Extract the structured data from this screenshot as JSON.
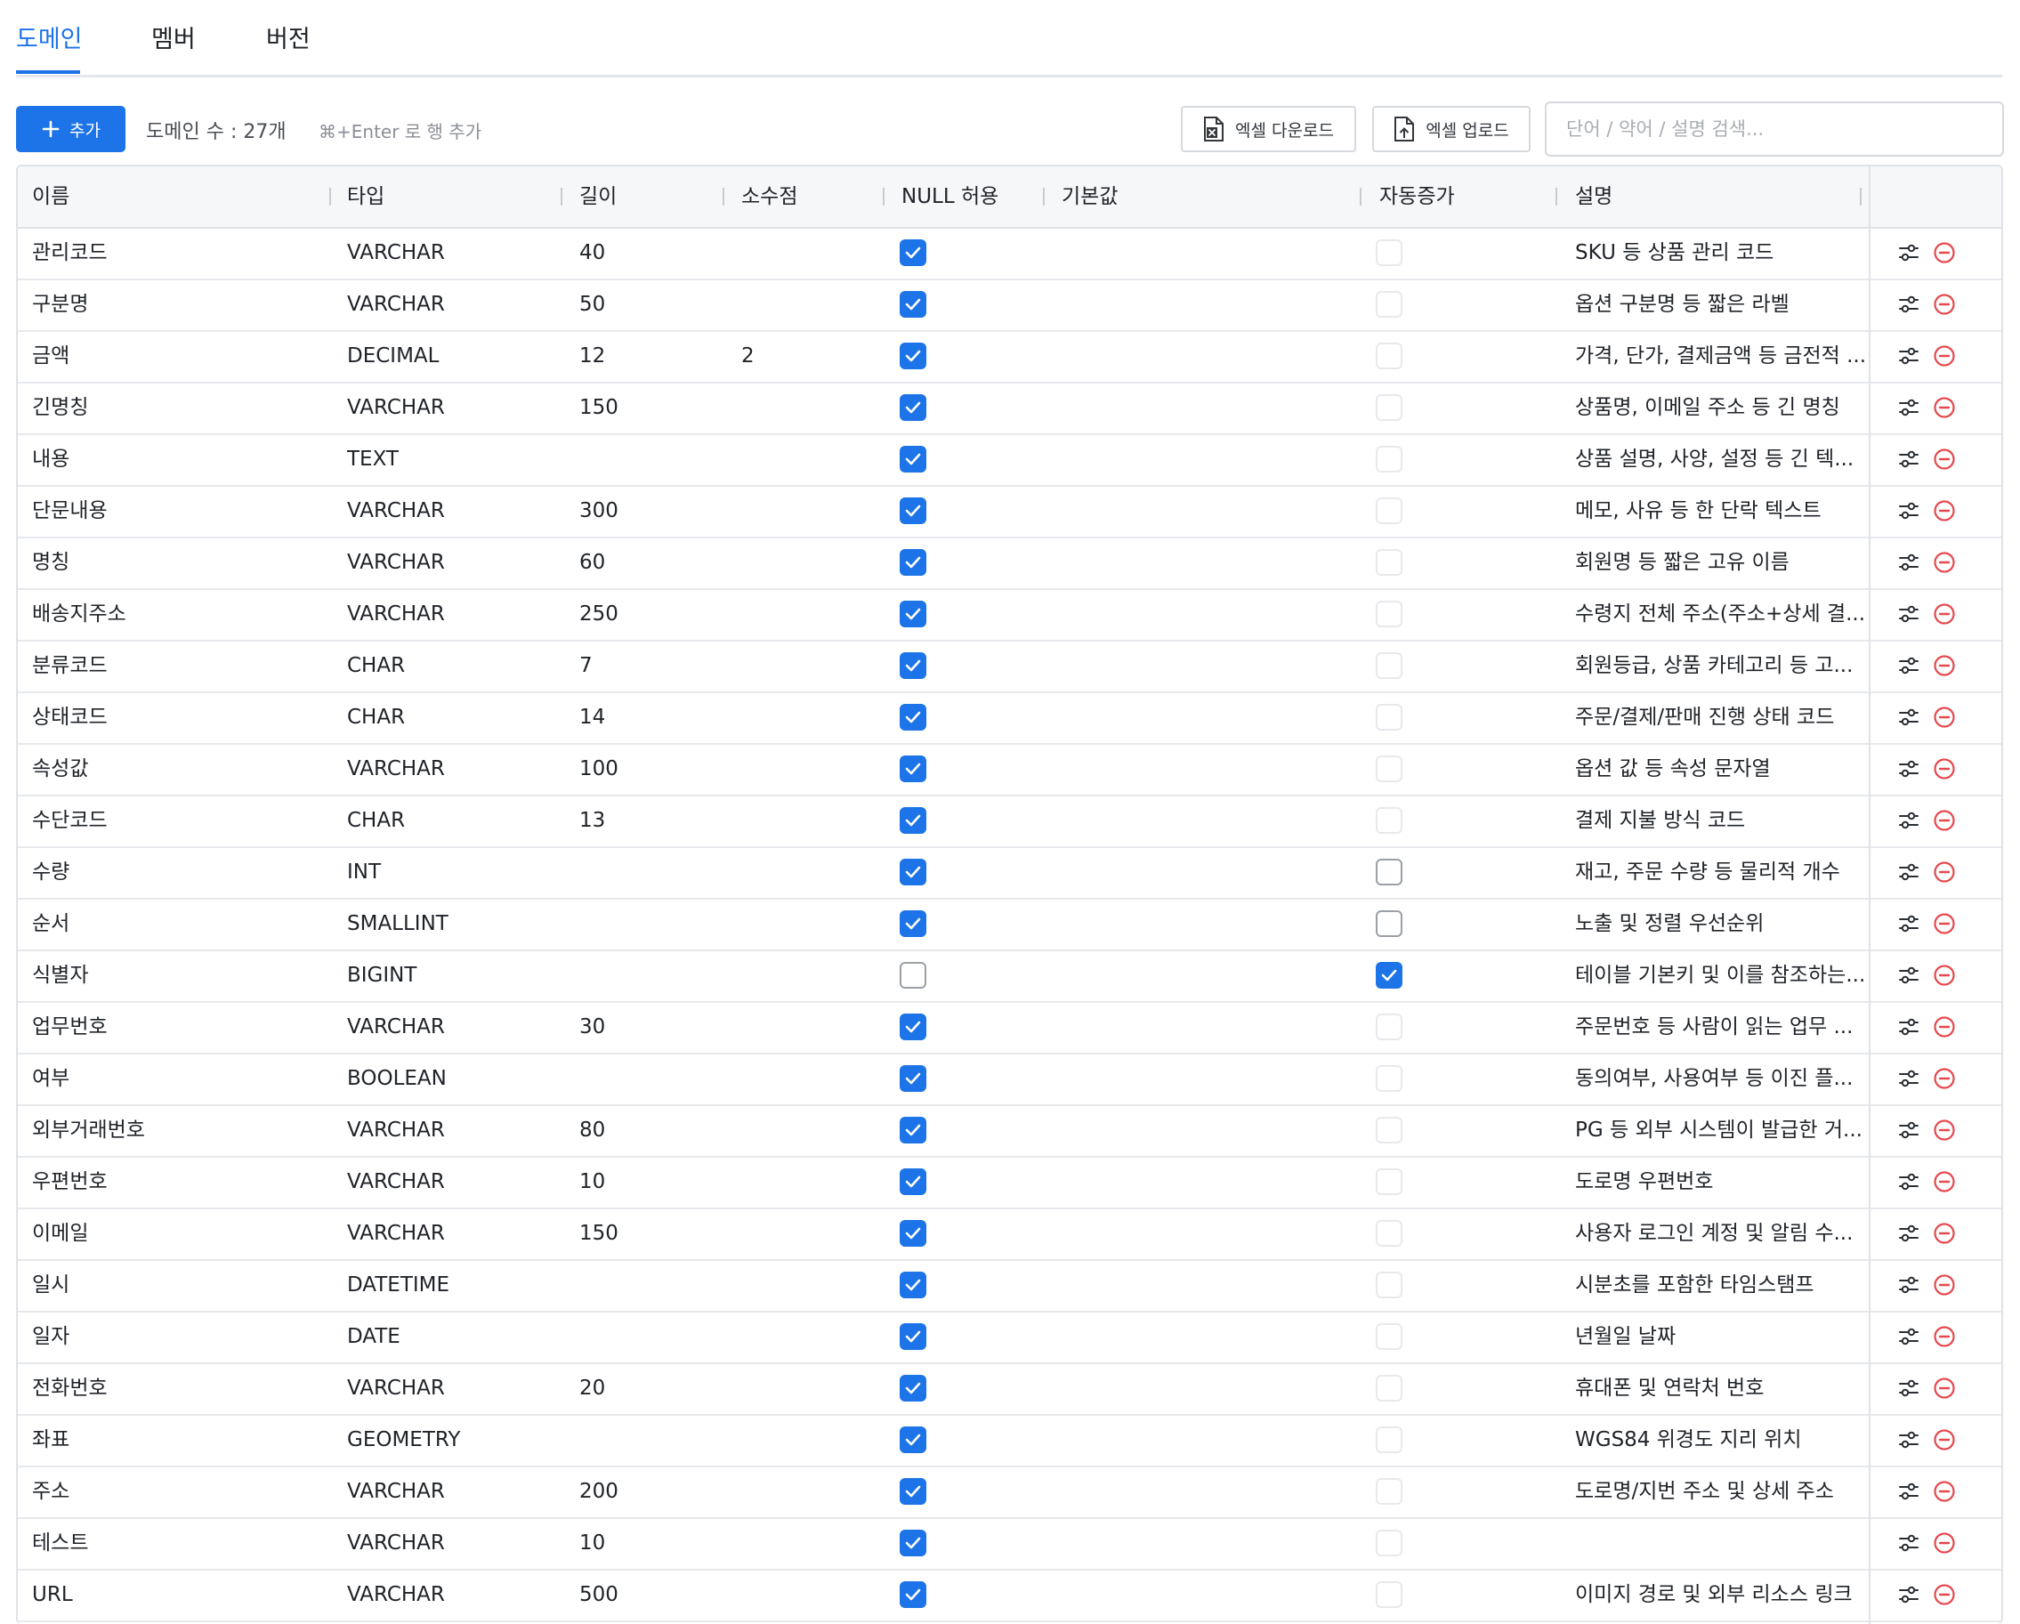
{
  "tabs": [
    {
      "label": "도메인",
      "active": true
    },
    {
      "label": "멤버",
      "active": false
    },
    {
      "label": "버전",
      "active": false
    }
  ],
  "toolbar": {
    "add_label": "추가",
    "count_text": "도메인 수 : 27개",
    "hint_text": "⌘+Enter 로 행 추가",
    "excel_download_label": "엑셀 다운로드",
    "excel_upload_label": "엑셀 업로드",
    "search_placeholder": "단어 / 약어 / 설명 검색..."
  },
  "colors": {
    "accent": "#1d74e8",
    "danger": "#e5484d"
  },
  "table": {
    "headers": [
      "이름",
      "타입",
      "길이",
      "소수점",
      "NULL 허용",
      "기본값",
      "자동증가",
      "설명",
      ""
    ],
    "rows": [
      {
        "name": "관리코드",
        "type": "VARCHAR",
        "length": "40",
        "scale": "",
        "nullable": true,
        "default": "",
        "auto": "disabled",
        "desc": "SKU 등 상품 관리 코드"
      },
      {
        "name": "구분명",
        "type": "VARCHAR",
        "length": "50",
        "scale": "",
        "nullable": true,
        "default": "",
        "auto": "disabled",
        "desc": "옵션 구분명 등 짧은 라벨"
      },
      {
        "name": "금액",
        "type": "DECIMAL",
        "length": "12",
        "scale": "2",
        "nullable": true,
        "default": "",
        "auto": "disabled",
        "desc": "가격, 단가, 결제금액 등 금전적 ..."
      },
      {
        "name": "긴명칭",
        "type": "VARCHAR",
        "length": "150",
        "scale": "",
        "nullable": true,
        "default": "",
        "auto": "disabled",
        "desc": "상품명, 이메일 주소 등 긴 명칭"
      },
      {
        "name": "내용",
        "type": "TEXT",
        "length": "",
        "scale": "",
        "nullable": true,
        "default": "",
        "auto": "disabled",
        "desc": "상품 설명, 사양, 설정 등 긴 텍..."
      },
      {
        "name": "단문내용",
        "type": "VARCHAR",
        "length": "300",
        "scale": "",
        "nullable": true,
        "default": "",
        "auto": "disabled",
        "desc": "메모, 사유 등 한 단락 텍스트"
      },
      {
        "name": "명칭",
        "type": "VARCHAR",
        "length": "60",
        "scale": "",
        "nullable": true,
        "default": "",
        "auto": "disabled",
        "desc": "회원명 등 짧은 고유 이름"
      },
      {
        "name": "배송지주소",
        "type": "VARCHAR",
        "length": "250",
        "scale": "",
        "nullable": true,
        "default": "",
        "auto": "disabled",
        "desc": "수령지 전체 주소(주소+상세 결..."
      },
      {
        "name": "분류코드",
        "type": "CHAR",
        "length": "7",
        "scale": "",
        "nullable": true,
        "default": "",
        "auto": "disabled",
        "desc": "회원등급, 상품 카테고리 등 고..."
      },
      {
        "name": "상태코드",
        "type": "CHAR",
        "length": "14",
        "scale": "",
        "nullable": true,
        "default": "",
        "auto": "disabled",
        "desc": "주문/결제/판매 진행 상태 코드"
      },
      {
        "name": "속성값",
        "type": "VARCHAR",
        "length": "100",
        "scale": "",
        "nullable": true,
        "default": "",
        "auto": "disabled",
        "desc": "옵션 값 등 속성 문자열"
      },
      {
        "name": "수단코드",
        "type": "CHAR",
        "length": "13",
        "scale": "",
        "nullable": true,
        "default": "",
        "auto": "disabled",
        "desc": "결제 지불 방식 코드"
      },
      {
        "name": "수량",
        "type": "INT",
        "length": "",
        "scale": "",
        "nullable": true,
        "default": "",
        "auto": "unchecked",
        "desc": "재고, 주문 수량 등 물리적 개수"
      },
      {
        "name": "순서",
        "type": "SMALLINT",
        "length": "",
        "scale": "",
        "nullable": true,
        "default": "",
        "auto": "unchecked",
        "desc": "노출 및 정렬 우선순위"
      },
      {
        "name": "식별자",
        "type": "BIGINT",
        "length": "",
        "scale": "",
        "nullable": false,
        "default": "",
        "auto": "checked",
        "desc": "테이블 기본키 및 이를 참조하는..."
      },
      {
        "name": "업무번호",
        "type": "VARCHAR",
        "length": "30",
        "scale": "",
        "nullable": true,
        "default": "",
        "auto": "disabled",
        "desc": "주문번호 등 사람이 읽는 업무 ..."
      },
      {
        "name": "여부",
        "type": "BOOLEAN",
        "length": "",
        "scale": "",
        "nullable": true,
        "default": "",
        "auto": "disabled",
        "desc": "동의여부, 사용여부 등 이진 플..."
      },
      {
        "name": "외부거래번호",
        "type": "VARCHAR",
        "length": "80",
        "scale": "",
        "nullable": true,
        "default": "",
        "auto": "disabled",
        "desc": "PG 등 외부 시스템이 발급한 거..."
      },
      {
        "name": "우편번호",
        "type": "VARCHAR",
        "length": "10",
        "scale": "",
        "nullable": true,
        "default": "",
        "auto": "disabled",
        "desc": "도로명 우편번호"
      },
      {
        "name": "이메일",
        "type": "VARCHAR",
        "length": "150",
        "scale": "",
        "nullable": true,
        "default": "",
        "auto": "disabled",
        "desc": "사용자 로그인 계정 및 알림 수..."
      },
      {
        "name": "일시",
        "type": "DATETIME",
        "length": "",
        "scale": "",
        "nullable": true,
        "default": "",
        "auto": "disabled",
        "desc": "시분초를 포함한 타임스탬프"
      },
      {
        "name": "일자",
        "type": "DATE",
        "length": "",
        "scale": "",
        "nullable": true,
        "default": "",
        "auto": "disabled",
        "desc": "년월일 날짜"
      },
      {
        "name": "전화번호",
        "type": "VARCHAR",
        "length": "20",
        "scale": "",
        "nullable": true,
        "default": "",
        "auto": "disabled",
        "desc": "휴대폰 및 연락처 번호"
      },
      {
        "name": "좌표",
        "type": "GEOMETRY",
        "length": "",
        "scale": "",
        "nullable": true,
        "default": "",
        "auto": "disabled",
        "desc": "WGS84 위경도 지리 위치"
      },
      {
        "name": "주소",
        "type": "VARCHAR",
        "length": "200",
        "scale": "",
        "nullable": true,
        "default": "",
        "auto": "disabled",
        "desc": "도로명/지번 주소 및 상세 주소"
      },
      {
        "name": "테스트",
        "type": "VARCHAR",
        "length": "10",
        "scale": "",
        "nullable": true,
        "default": "",
        "auto": "disabled",
        "desc": ""
      },
      {
        "name": "URL",
        "type": "VARCHAR",
        "length": "500",
        "scale": "",
        "nullable": true,
        "default": "",
        "auto": "disabled",
        "desc": "이미지 경로 및 외부 리소스 링크"
      }
    ]
  }
}
